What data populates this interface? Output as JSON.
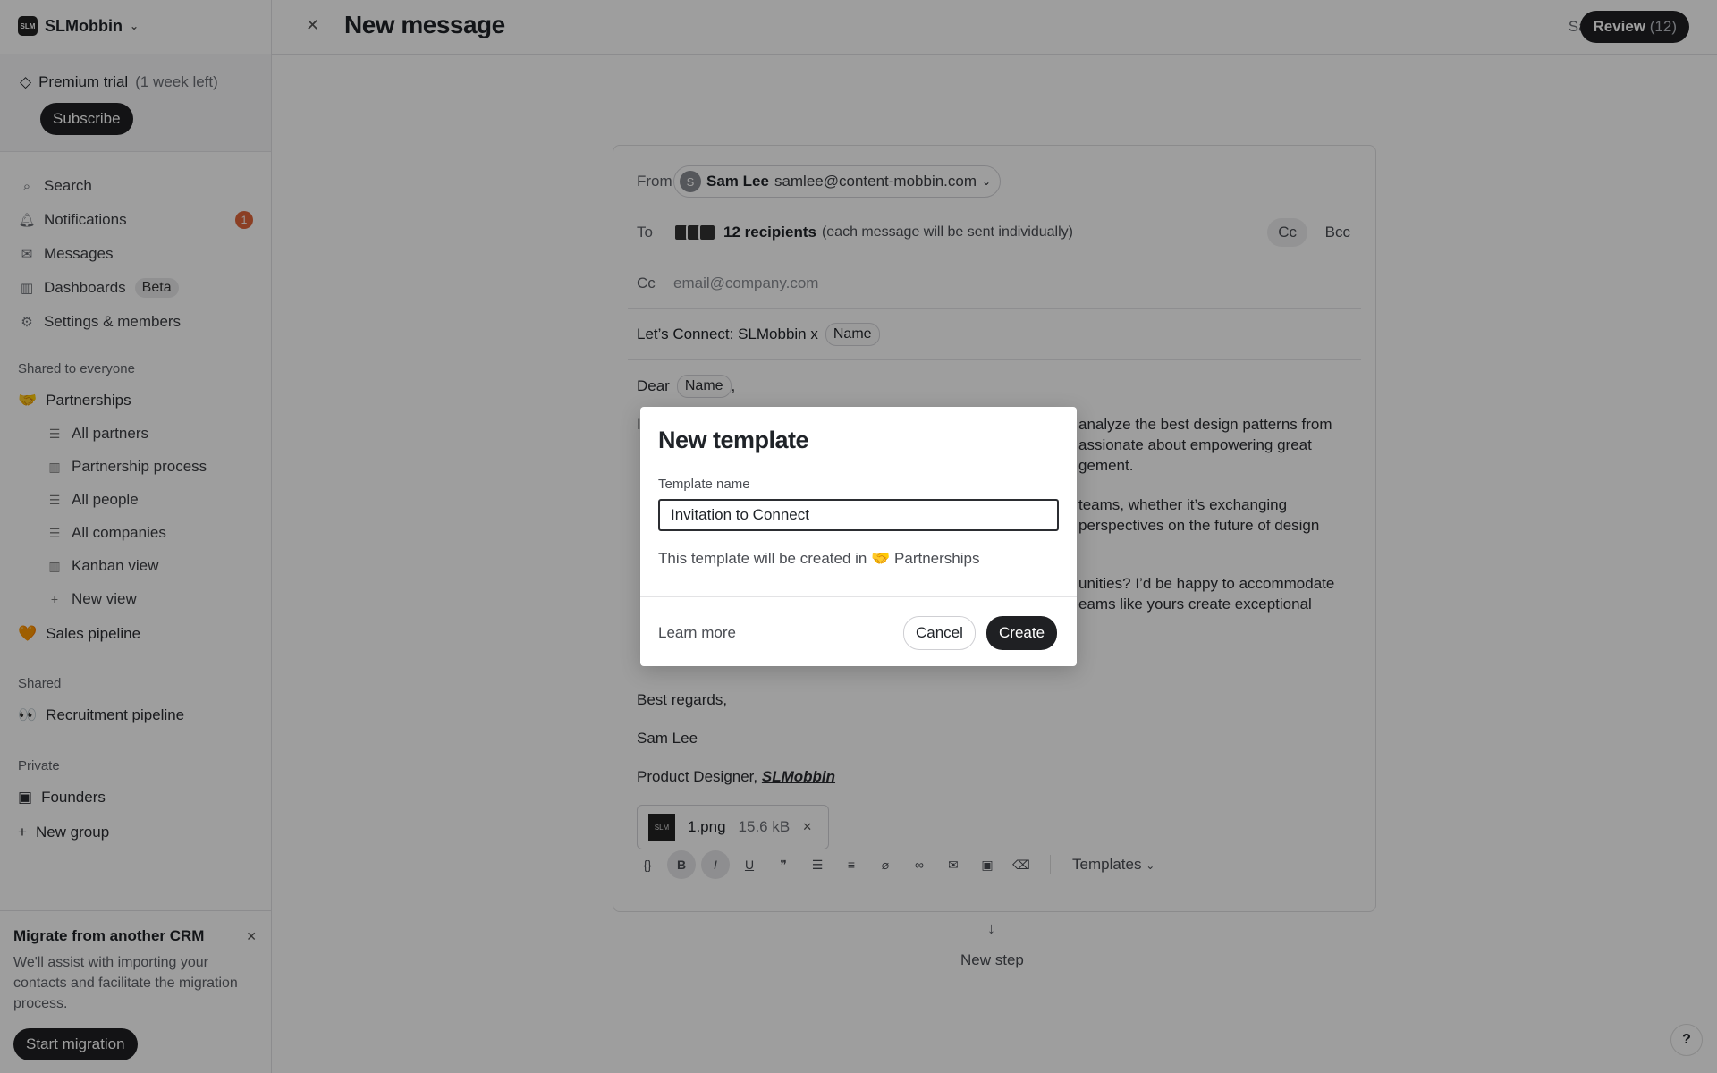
{
  "workspace": {
    "name": "SLMobbin",
    "logo_text": "SLM"
  },
  "trial": {
    "label": "Premium trial",
    "remaining": "(1 week left)",
    "subscribe": "Subscribe"
  },
  "nav": {
    "search": "Search",
    "notifications": "Notifications",
    "notifications_count": "1",
    "messages": "Messages",
    "dashboards": "Dashboards",
    "dashboards_badge": "Beta",
    "settings": "Settings & members"
  },
  "sections": {
    "shared_everyone": "Shared to everyone",
    "shared": "Shared",
    "private": "Private"
  },
  "groups": {
    "partnerships": "Partnerships",
    "partnerships_views": [
      "All partners",
      "Partnership process",
      "All people",
      "All companies",
      "Kanban view",
      "New view"
    ],
    "sales": "Sales pipeline",
    "recruitment": "Recruitment pipeline",
    "founders": "Founders",
    "new_group": "New group"
  },
  "migrate": {
    "title": "Migrate from another CRM",
    "text": "We'll assist with importing your contacts and facilitate the migration process.",
    "button": "Start migration"
  },
  "header": {
    "title": "New message",
    "saved": "Saved",
    "review": "Review",
    "review_count": "(12)"
  },
  "composer": {
    "from_label": "From",
    "from_avatar": "S",
    "from_name": "Sam Lee",
    "from_email": "samlee@content-mobbin.com",
    "to_label": "To",
    "recipients": "12 recipients",
    "recipients_note": "(each message will be sent individually)",
    "cc_button": "Cc",
    "bcc_button": "Bcc",
    "cc_label": "Cc",
    "cc_placeholder": "email@company.com",
    "subject": "Let’s Connect: SLMobbin x",
    "subject_chip": "Name",
    "greeting": "Dear",
    "greeting_chip": "Name",
    "greeting_end": ",",
    "p1a": "I",
    "p1b": "analyze the best design patterns from",
    "p1c": "assionate about empowering great",
    "p1d": "gement.",
    "p2b": "teams, whether it’s exchanging",
    "p2c": "perspectives on the future of design",
    "p3b": "unities? I’d be happy to accommodate",
    "p3c": "eams like yours create exceptional",
    "closing": "Best regards,",
    "signature_name": "Sam Lee",
    "signature_title": "Product Designer,",
    "signature_company": "SLMobbin",
    "attachment_name": "1.png",
    "attachment_size": "15.6 kB",
    "templates": "Templates"
  },
  "new_step": "New step",
  "help": "?",
  "modal": {
    "title": "New template",
    "name_label": "Template name",
    "name_value": "Invitation to Connect",
    "note_prefix": "This template will be created in",
    "note_group": "Partnerships",
    "learn_more": "Learn more",
    "cancel": "Cancel",
    "create": "Create"
  }
}
